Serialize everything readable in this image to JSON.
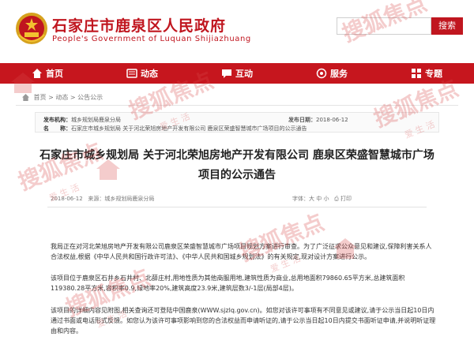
{
  "header": {
    "title": "石家庄市鹿泉区人民政府",
    "subtitle": "People's Government of Luquan Shijiazhuang",
    "search_placeholder": "",
    "search_button": "搜索"
  },
  "nav": {
    "items": [
      {
        "label": "首页",
        "icon": "home-icon"
      },
      {
        "label": "动态",
        "icon": "news-icon"
      },
      {
        "label": "互动",
        "icon": "chat-icon"
      },
      {
        "label": "服务",
        "icon": "service-icon"
      },
      {
        "label": "专题",
        "icon": "topic-icon"
      }
    ]
  },
  "breadcrumb": {
    "home": "首页",
    "sep": " > ",
    "l2": "动态",
    "l3": "公告公示"
  },
  "info": {
    "org_label": "发布机构：",
    "org_value": "城乡规划局鹿泉分局",
    "name_label": "名　　称：",
    "name_value": "石家庄市城乡规划局 关于河北荣旭房地产开发有限公司 鹿泉区荣盛智慧城市广场项目的公示通告",
    "date_label": "发布日期：",
    "date_value": "2018-06-12"
  },
  "article": {
    "title_line1": "石家庄市城乡规划局 关于河北荣旭房地产开发有限公司 鹿泉区荣盛智慧城市广场",
    "title_line2": "项目的公示通告",
    "date": "2018-06-12",
    "source": "来源：城乡规划局鹿泉分局",
    "font_tools": "字体：大 中 小",
    "print": "打印",
    "p1": "我局正在对河北荣旭房地产开发有限公司鹿泉区荣盛智慧城市广场项目规划方案进行审查。为了广泛征求公众意见和建议,保障利害关系人合法权益,根据《中华人民共和国行政许可法》、《中华人民共和国城乡规划法》的有关规定,现对设计方案进行公示。",
    "p2": "该项目位于鹿泉区石井乡石井村、北薛庄村,用地性质为其他商服用地,建筑性质为商业,总用地面积79860.65平方米,总建筑面积119380.28平方米,容积率0.9,绿地率20%,建筑高度23.9米,建筑层数3/-1层(局部4层)。",
    "p3": "该项目的详细内容见附图,相关查询还可登陆中国鹿泉(WWW.sjzlq.gov.cn)。如您对该许可事项有不同意见或建议,请于公示当日起10日内通过书面或电话形式反馈。如您认为该许可事项影响到您的合法权益而申请听证的,请于公示当日起10日内提交书面听证申请,并说明听证理由和内容。"
  },
  "watermark": {
    "text": "搜狐焦点",
    "sub": "爱 生 活"
  },
  "colors": {
    "brand_red": "#c0161f",
    "nav_red": "#c6161e"
  }
}
